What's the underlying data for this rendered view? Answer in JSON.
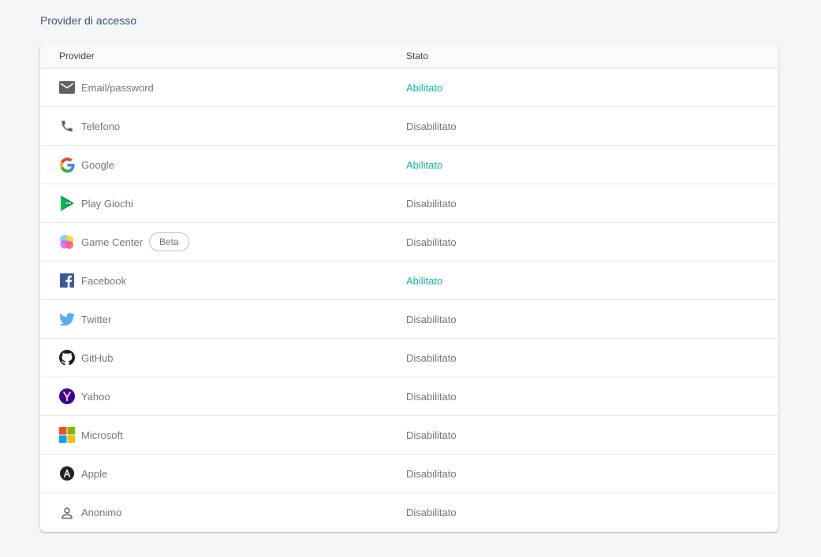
{
  "section_title": "Provider di accesso",
  "table": {
    "columns": {
      "provider": "Provider",
      "status": "Stato"
    },
    "rows": [
      {
        "name": "Email/password",
        "icon": "email-icon",
        "status": "Abilitato",
        "enabled": true
      },
      {
        "name": "Telefono",
        "icon": "phone-icon",
        "status": "Disabilitato",
        "enabled": false
      },
      {
        "name": "Google",
        "icon": "google-icon",
        "status": "Abilitato",
        "enabled": true
      },
      {
        "name": "Play Giochi",
        "icon": "play-games-icon",
        "status": "Disabilitato",
        "enabled": false
      },
      {
        "name": "Game Center",
        "icon": "game-center-icon",
        "status": "Disabilitato",
        "enabled": false,
        "badge": "Beta"
      },
      {
        "name": "Facebook",
        "icon": "facebook-icon",
        "status": "Abilitato",
        "enabled": true
      },
      {
        "name": "Twitter",
        "icon": "twitter-icon",
        "status": "Disabilitato",
        "enabled": false
      },
      {
        "name": "GitHub",
        "icon": "github-icon",
        "status": "Disabilitato",
        "enabled": false
      },
      {
        "name": "Yahoo",
        "icon": "yahoo-icon",
        "status": "Disabilitato",
        "enabled": false
      },
      {
        "name": "Microsoft",
        "icon": "microsoft-icon",
        "status": "Disabilitato",
        "enabled": false
      },
      {
        "name": "Apple",
        "icon": "apple-icon",
        "status": "Disabilitato",
        "enabled": false
      },
      {
        "name": "Anonimo",
        "icon": "anonymous-user-icon",
        "status": "Disabilitato",
        "enabled": false
      }
    ]
  },
  "colors": {
    "enabled_status": "#12b5a5",
    "disabled_status": "#757575",
    "section_title": "#3c5379"
  }
}
